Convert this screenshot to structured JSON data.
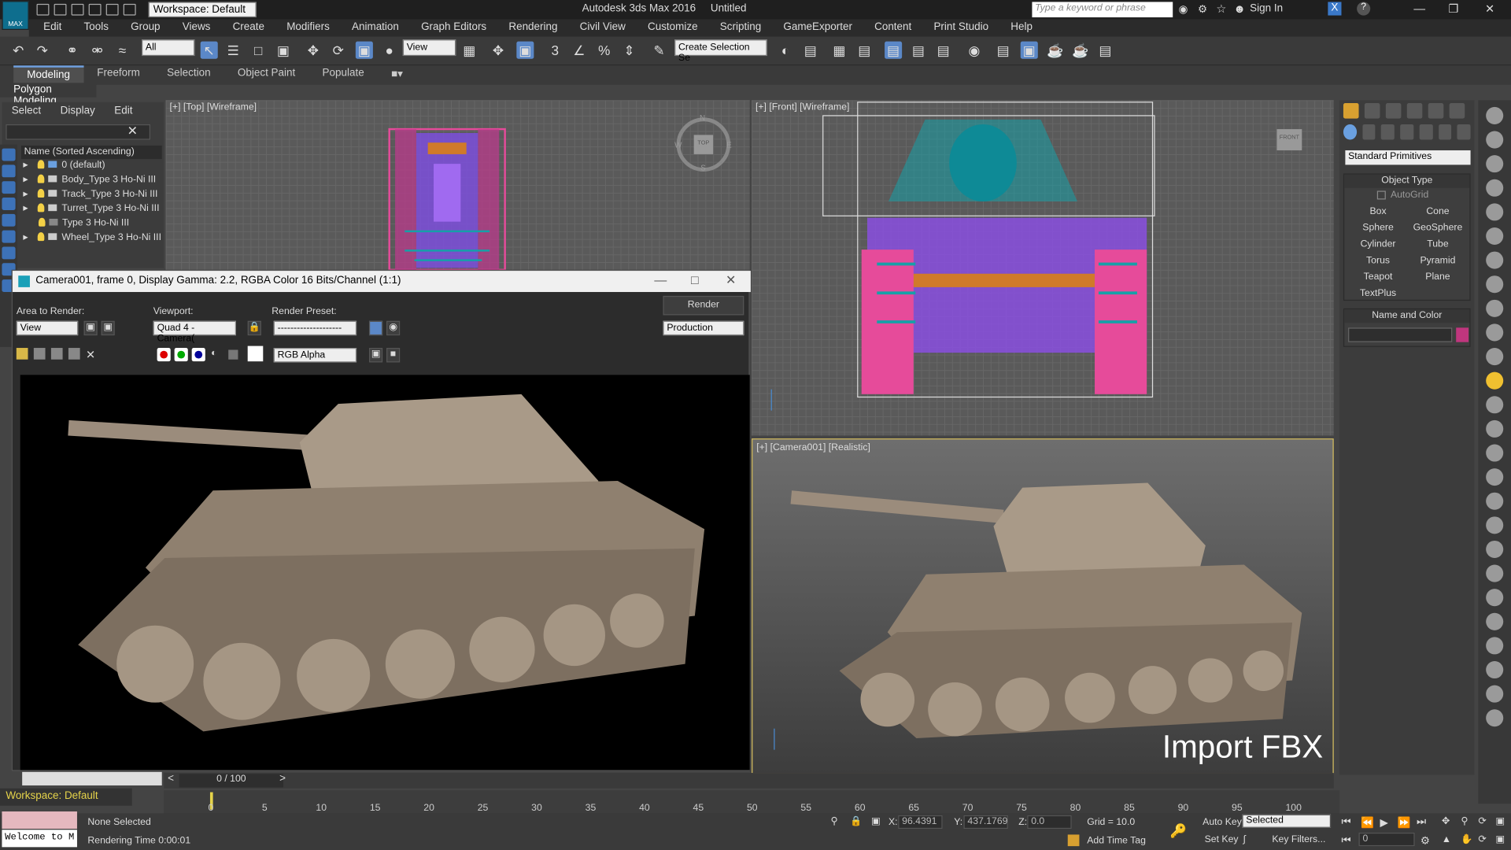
{
  "app": {
    "title": "Autodesk 3ds Max 2016",
    "doc": "Untitled",
    "workspace": "Workspace: Default",
    "search_placeholder": "Type a keyword or phrase",
    "sign_in": "Sign In",
    "logo": "MAX"
  },
  "menu": [
    "Edit",
    "Tools",
    "Group",
    "Views",
    "Create",
    "Modifiers",
    "Animation",
    "Graph Editors",
    "Rendering",
    "Civil View",
    "Customize",
    "Scripting",
    "GameExporter",
    "Content",
    "Print Studio",
    "Help"
  ],
  "toolbar": {
    "selection_filter": "All",
    "ref_coord": "View",
    "selection_set": "Create Selection Se"
  },
  "ribbon": {
    "tabs": [
      "Modeling",
      "Freeform",
      "Selection",
      "Object Paint",
      "Populate"
    ],
    "sub": "Polygon Modeling"
  },
  "scene_explorer": {
    "tabs": [
      "Select",
      "Display",
      "Edit"
    ],
    "header": "Name (Sorted Ascending)",
    "items": [
      "0 (default)",
      "Body_Type 3 Ho-Ni III",
      "Track_Type 3 Ho-Ni III",
      "Turret_Type 3 Ho-Ni III",
      "Type 3 Ho-Ni III",
      "Wheel_Type 3 Ho-Ni III"
    ]
  },
  "viewports": {
    "top": "[+] [Top] [Wireframe]",
    "front": "[+] [Front] [Wireframe]",
    "camera": "[+] [Camera001] [Realistic]",
    "cube_top": "TOP",
    "cube_front": "FRONT",
    "compass": [
      "N",
      "W",
      "E",
      "S"
    ],
    "overlay": "Import FBX"
  },
  "render_window": {
    "title": "Camera001, frame 0, Display Gamma: 2.2, RGBA Color 16 Bits/Channel (1:1)",
    "area_label": "Area to Render:",
    "area_value": "View",
    "viewport_label": "Viewport:",
    "viewport_value": "Quad 4 - Camera(",
    "preset_label": "Render Preset:",
    "preset_value": "--------------------",
    "render_btn": "Render",
    "mode_value": "Production",
    "channel_value": "RGB Alpha"
  },
  "command_panel": {
    "category": "Standard Primitives",
    "object_type": "Object Type",
    "autogrid": "AutoGrid",
    "primitives": [
      "Box",
      "Cone",
      "Sphere",
      "GeoSphere",
      "Cylinder",
      "Tube",
      "Torus",
      "Pyramid",
      "Teapot",
      "Plane",
      "TextPlus"
    ],
    "name_color": "Name and Color",
    "swatch": "#c0367e"
  },
  "timeline": {
    "slider": "0 / 100",
    "ticks": [
      "0",
      "5",
      "10",
      "15",
      "20",
      "25",
      "30",
      "35",
      "40",
      "45",
      "50",
      "55",
      "60",
      "65",
      "70",
      "75",
      "80",
      "85",
      "90",
      "95",
      "100"
    ]
  },
  "status": {
    "workspace": "Workspace: Default",
    "welcome": "Welcome to M",
    "selection": "None Selected",
    "render_time": "Rendering Time  0:00:01",
    "x_label": "X:",
    "x": "96.4391",
    "y_label": "Y:",
    "y": "437.1769",
    "z_label": "Z:",
    "z": "0.0",
    "grid": "Grid = 10.0",
    "add_time_tag": "Add Time Tag",
    "auto_key": "Auto Key",
    "key_mode": "Selected",
    "set_key": "Set Key",
    "key_filters": "Key Filters...",
    "frame": "0"
  },
  "colors": {
    "accent": "#5b88c8",
    "wire_purple": "#9a4ee8",
    "wire_pink": "#e64b9a",
    "wire_teal": "#16a0a8",
    "tank": "#9b8c7c"
  }
}
